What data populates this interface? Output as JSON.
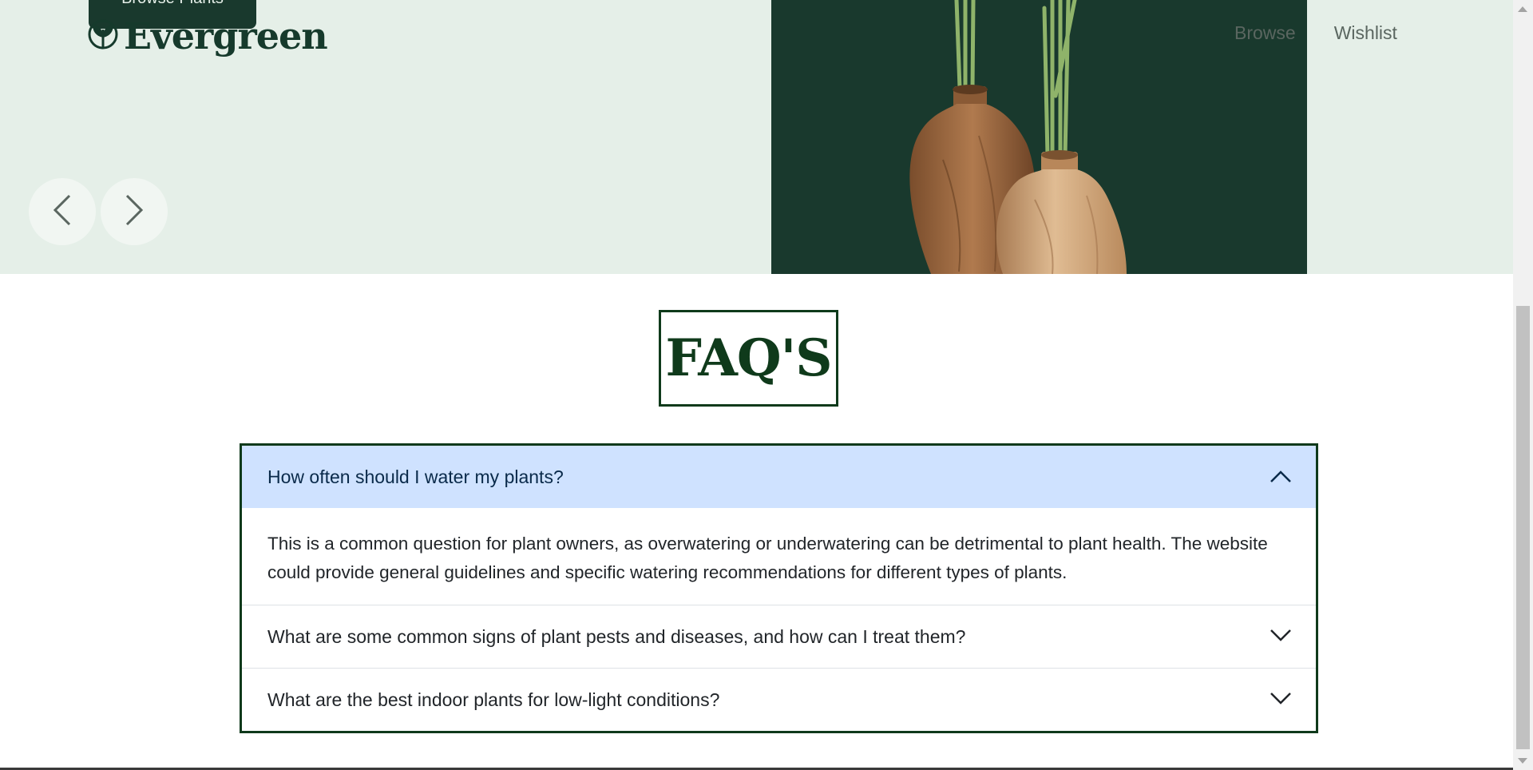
{
  "hero": {
    "browse_button": "Browse Plants",
    "brand": "Evergreen",
    "nav": [
      "Browse",
      "Wishlist"
    ],
    "prev_label": "Previous",
    "next_label": "Next"
  },
  "faq": {
    "title": "FAQ'S",
    "items": [
      {
        "question": "How often should I water my plants?",
        "answer": "This is a common question for plant owners, as overwatering or underwatering can be detrimental to plant health. The website could provide general guidelines and specific watering recommendations for different types of plants.",
        "expanded": true
      },
      {
        "question": "What are some common signs of plant pests and diseases, and how can I treat them?",
        "expanded": false
      },
      {
        "question": "What are the best indoor plants for low-light conditions?",
        "expanded": false
      }
    ]
  },
  "colors": {
    "hero_bg": "#e5efe8",
    "dark_green": "#19392d",
    "faq_border": "#0f3a1b",
    "open_header": "#cfe2ff"
  }
}
